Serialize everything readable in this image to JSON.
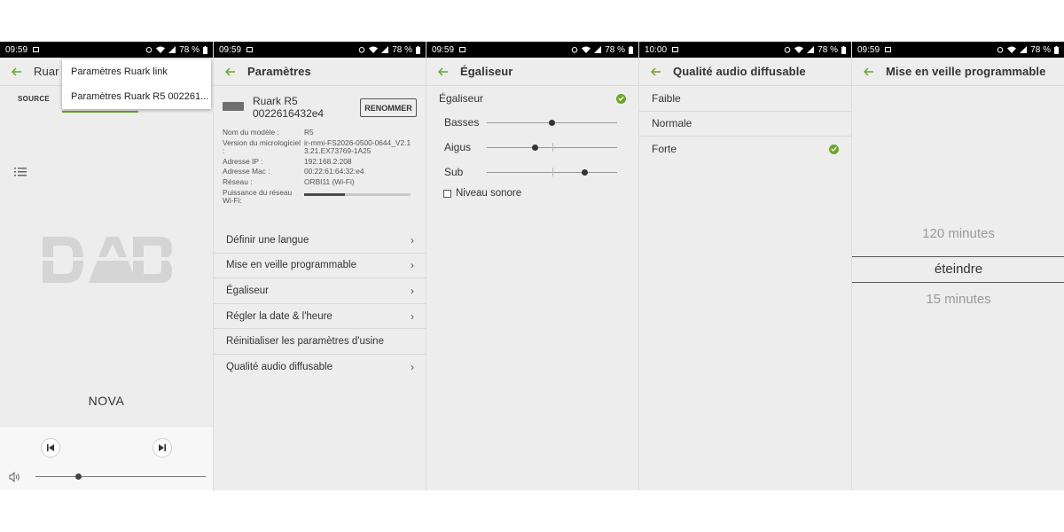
{
  "screens": [
    {
      "status": {
        "time": "09:59",
        "battery": "78 %"
      },
      "header": {
        "title_partial": "Ruar"
      },
      "dropdown": {
        "items": [
          "Paramètres Ruark link",
          "Paramètres Ruark R5 002261..."
        ]
      },
      "source_tab": "SOURCE",
      "station": "NOVA"
    },
    {
      "status": {
        "time": "09:59",
        "battery": "78 %"
      },
      "title": "Paramètres",
      "device": {
        "name": "Ruark R5",
        "id": "0022616432e4",
        "rename": "RENOMMER"
      },
      "info": [
        {
          "label": "Nom du modèle :",
          "value": "R5"
        },
        {
          "label": "Version du micrologiciel :",
          "value": "ir-mmi-FS2026-0500-0644_V2.13.21.EX73769-1A25"
        },
        {
          "label": "Adresse IP :",
          "value": "192.168.2.208"
        },
        {
          "label": "Adresse Mac :",
          "value": "00:22:61:64:32:e4"
        },
        {
          "label": "Réseau :",
          "value": "ORBI11 (Wi-Fi)"
        },
        {
          "label": "Puissance du réseau Wi-Fi:",
          "value": ""
        }
      ],
      "wifi_strength": 0.38,
      "menu": [
        {
          "label": "Définir une langue",
          "chevron": true
        },
        {
          "label": "Mise en veille programmable",
          "chevron": true
        },
        {
          "label": "Égaliseur",
          "chevron": true
        },
        {
          "label": "Régler la date & l'heure",
          "chevron": true
        },
        {
          "label": "Réinitialiser les paramètres d'usine",
          "chevron": false
        },
        {
          "label": "Qualité audio diffusable",
          "chevron": true
        }
      ]
    },
    {
      "status": {
        "time": "09:59",
        "battery": "78 %"
      },
      "title": "Égaliseur",
      "toggle_label": "Égaliseur",
      "sliders": [
        {
          "name": "Basses",
          "value": 0.5
        },
        {
          "name": "Aigus",
          "value": 0.37
        },
        {
          "name": "Sub",
          "value": 0.75
        }
      ],
      "volume_label": "Niveau sonore"
    },
    {
      "status": {
        "time": "10:00",
        "battery": "78 %"
      },
      "title": "Qualité audio diffusable",
      "options": [
        "Faible",
        "Normale",
        "Forte"
      ],
      "selected": "Forte"
    },
    {
      "status": {
        "time": "09:59",
        "battery": "78 %"
      },
      "title": "Mise en veille programmable",
      "picker": {
        "above": "120 minutes",
        "selected": "éteindre",
        "below": "15 minutes"
      }
    }
  ],
  "colors": {
    "accent": "#6da52a",
    "status_bar": "#000000",
    "background": "#ededed"
  },
  "icons": {
    "back": "arrow-left-icon",
    "list": "list-icon",
    "prev": "skip-previous-icon",
    "next": "skip-next-icon",
    "volume": "speaker-icon",
    "check": "check-circle-icon",
    "chevron": "chevron-right-icon"
  }
}
